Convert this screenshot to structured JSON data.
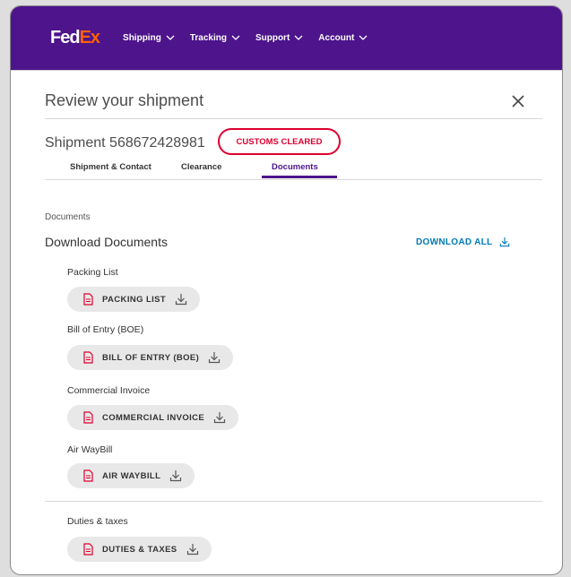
{
  "brand": {
    "logo_part1": "Fed",
    "logo_part2": "Ex",
    "color_purple": "#4d148c",
    "color_orange": "#ff6200"
  },
  "nav": [
    {
      "label": "Shipping",
      "icon": "chevron-down-icon"
    },
    {
      "label": "Tracking",
      "icon": "chevron-down-icon"
    },
    {
      "label": "Support",
      "icon": "chevron-down-icon"
    },
    {
      "label": "Account",
      "icon": "chevron-down-icon"
    }
  ],
  "panel": {
    "title": "Review your shipment",
    "close_icon": "close-icon",
    "shipment_label": "Shipment 568672428981",
    "status_badge": "CUSTOMS CLEARED",
    "status_color": "#de002e",
    "tabs": [
      {
        "label": "Shipment & Contact",
        "active": false
      },
      {
        "label": "Clearance",
        "active": false
      },
      {
        "label": "Documents",
        "active": true
      }
    ]
  },
  "documents": {
    "section_label": "Documents",
    "heading": "Download Documents",
    "download_all": "DOWNLOAD ALL",
    "link_color": "#007ab7",
    "items": [
      {
        "label": "Packing List",
        "button": "PACKING LIST"
      },
      {
        "label": "Bill of Entry (BOE)",
        "button": "BILL OF ENTRY (BOE)"
      },
      {
        "label": "Commercial Invoice",
        "button": "COMMERCIAL INVOICE"
      },
      {
        "label": "Air WayBill",
        "button": "AIR WAYBILL"
      },
      {
        "label": "Duties & taxes",
        "button": "DUTIES & TAXES"
      }
    ]
  }
}
